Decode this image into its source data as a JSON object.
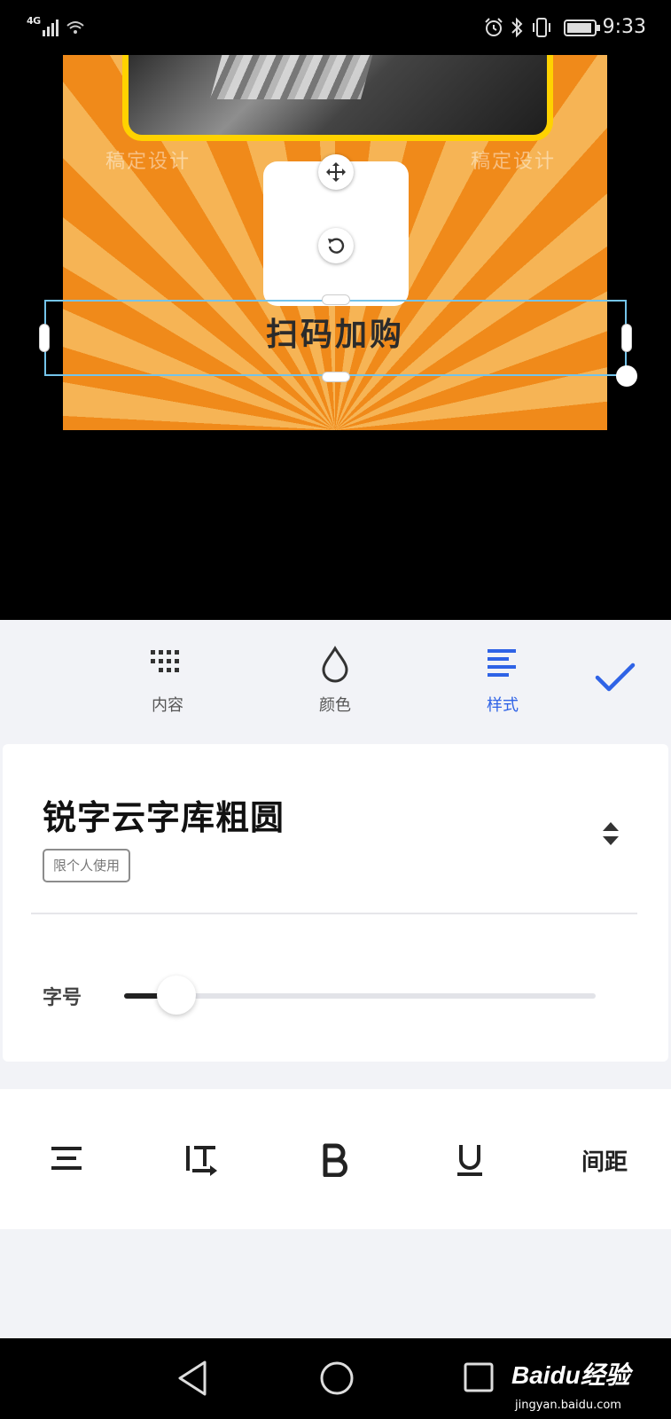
{
  "status_bar": {
    "network": "4G",
    "time": "9:33",
    "icons": [
      "signal-icon",
      "wifi-icon",
      "alarm-icon",
      "bluetooth-icon",
      "vibrate-icon",
      "battery-icon"
    ]
  },
  "canvas": {
    "watermark_left": "稿定设计",
    "watermark_right": "稿定设计",
    "title_text": "扫码加购",
    "colors": {
      "ray_dark": "#f08a1a",
      "ray_light": "#f6b455",
      "frame": "#ffd200",
      "selection": "#74c4ea"
    }
  },
  "toolbar": {
    "tabs": [
      {
        "label": "内容",
        "icon": "grid-icon",
        "active": false
      },
      {
        "label": "颜色",
        "icon": "droplet-icon",
        "active": false
      },
      {
        "label": "样式",
        "icon": "align-left-icon",
        "active": true
      }
    ],
    "confirm_icon": "check-icon",
    "accent_color": "#2f63e6"
  },
  "font": {
    "name": "锐字云字库粗圆",
    "license": "限个人使用",
    "picker_icon": "sort-arrows-icon"
  },
  "font_size": {
    "label": "字号",
    "level": 0.11
  },
  "style_row": {
    "buttons": [
      "align-center-icon",
      "vertical-text-icon",
      "bold-icon",
      "underline-icon"
    ],
    "spacing_label": "间距"
  },
  "nav_bar": {
    "buttons": [
      "back-icon",
      "home-icon",
      "recents-icon"
    ],
    "watermark_main": "Baidu经验",
    "watermark_sub": "jingyan.baidu.com"
  }
}
